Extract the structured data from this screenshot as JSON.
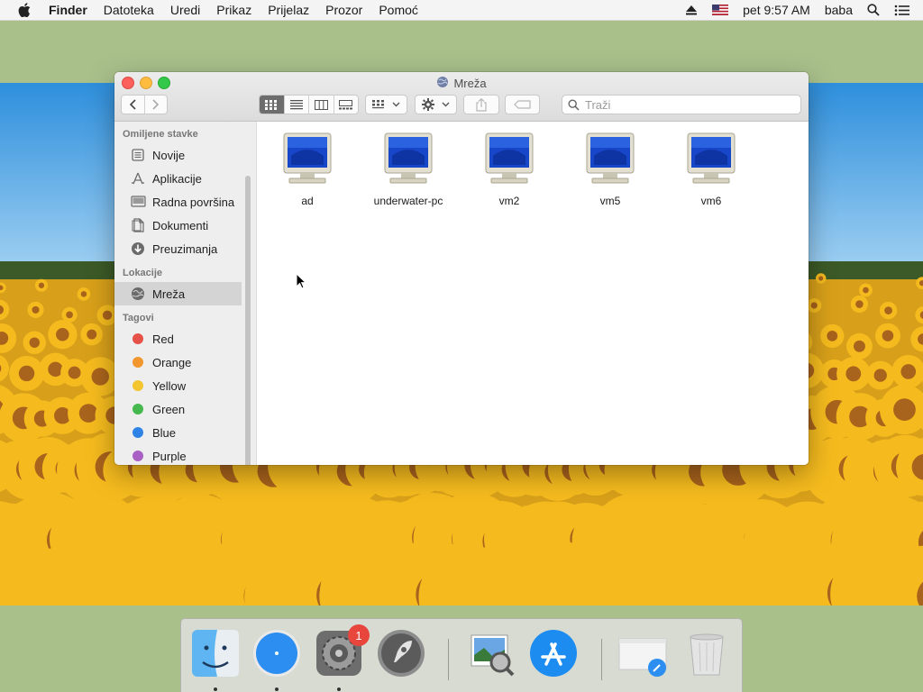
{
  "menubar": {
    "app_name": "Finder",
    "items": [
      "Datoteka",
      "Uredi",
      "Prikaz",
      "Prijelaz",
      "Prozor",
      "Pomoć"
    ],
    "clock": "pet 9:57 AM",
    "user": "baba"
  },
  "window": {
    "title": "Mreža",
    "search_placeholder": "Traži"
  },
  "sidebar": {
    "favorites_header": "Omiljene stavke",
    "favorites": [
      {
        "label": "Novije",
        "icon": "recents-icon"
      },
      {
        "label": "Aplikacije",
        "icon": "applications-icon"
      },
      {
        "label": "Radna površina",
        "icon": "desktop-icon"
      },
      {
        "label": "Dokumenti",
        "icon": "documents-icon"
      },
      {
        "label": "Preuzimanja",
        "icon": "downloads-icon"
      }
    ],
    "locations_header": "Lokacije",
    "locations": [
      {
        "label": "Mreža",
        "icon": "network-icon",
        "selected": true
      }
    ],
    "tags_header": "Tagovi",
    "tags": [
      {
        "label": "Red",
        "color": "#e55048"
      },
      {
        "label": "Orange",
        "color": "#f2962e"
      },
      {
        "label": "Yellow",
        "color": "#f3c630"
      },
      {
        "label": "Green",
        "color": "#45b94e"
      },
      {
        "label": "Blue",
        "color": "#2f82e6"
      },
      {
        "label": "Purple",
        "color": "#a960c4"
      }
    ]
  },
  "content": {
    "items": [
      {
        "label": "ad",
        "icon": "computer-icon"
      },
      {
        "label": "underwater-pc",
        "icon": "computer-icon"
      },
      {
        "label": "vm2",
        "icon": "computer-icon"
      },
      {
        "label": "vm5",
        "icon": "computer-icon"
      },
      {
        "label": "vm6",
        "icon": "computer-icon"
      }
    ]
  },
  "dock": {
    "items": [
      {
        "name": "finder-icon",
        "running": true
      },
      {
        "name": "safari-icon",
        "running": true
      },
      {
        "name": "system-preferences-icon",
        "running": true,
        "badge": "1"
      },
      {
        "name": "launchpad-icon",
        "running": false
      },
      {
        "name": "preview-icon",
        "running": false
      },
      {
        "name": "app-store-icon",
        "running": false
      },
      {
        "name": "downloads-stack-icon",
        "running": false
      },
      {
        "name": "trash-icon",
        "running": false
      }
    ]
  }
}
